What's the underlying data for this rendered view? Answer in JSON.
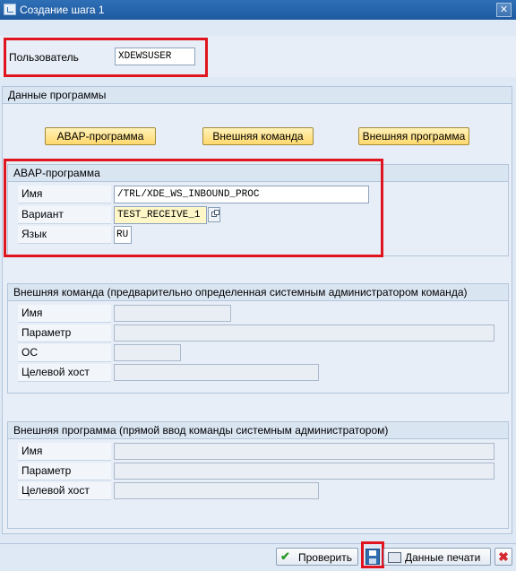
{
  "window": {
    "title": "Создание шага  1",
    "close_glyph": "✕"
  },
  "user": {
    "label": "Пользователь",
    "value": "XDEWSUSER"
  },
  "program_data": {
    "title": "Данные программы",
    "buttons": [
      "ABAP-программа",
      "Внешняя команда",
      "Внешняя программа"
    ]
  },
  "abap": {
    "title": "ABAP-программа",
    "name_label": "Имя",
    "name_value": "/TRL/XDE_WS_INBOUND_PROC",
    "variant_label": "Вариант",
    "variant_value": "TEST_RECEIVE_1",
    "lang_label": "Язык",
    "lang_value": "RU"
  },
  "ext_cmd": {
    "title": "Внешняя команда (предварительно определенная системным администратором команда)",
    "labels": [
      "Имя",
      "Параметр",
      "ОС",
      "Целевой хост"
    ]
  },
  "ext_prog": {
    "title": "Внешняя программа (прямой ввод команды системным администратором)",
    "labels": [
      "Имя",
      "Параметр",
      "Целевой хост"
    ]
  },
  "footer": {
    "check_label": "Проверить",
    "print_label": "Данные печати"
  },
  "colors": {
    "highlight": "#e0141e",
    "title_bar": "#2e6fb6"
  }
}
